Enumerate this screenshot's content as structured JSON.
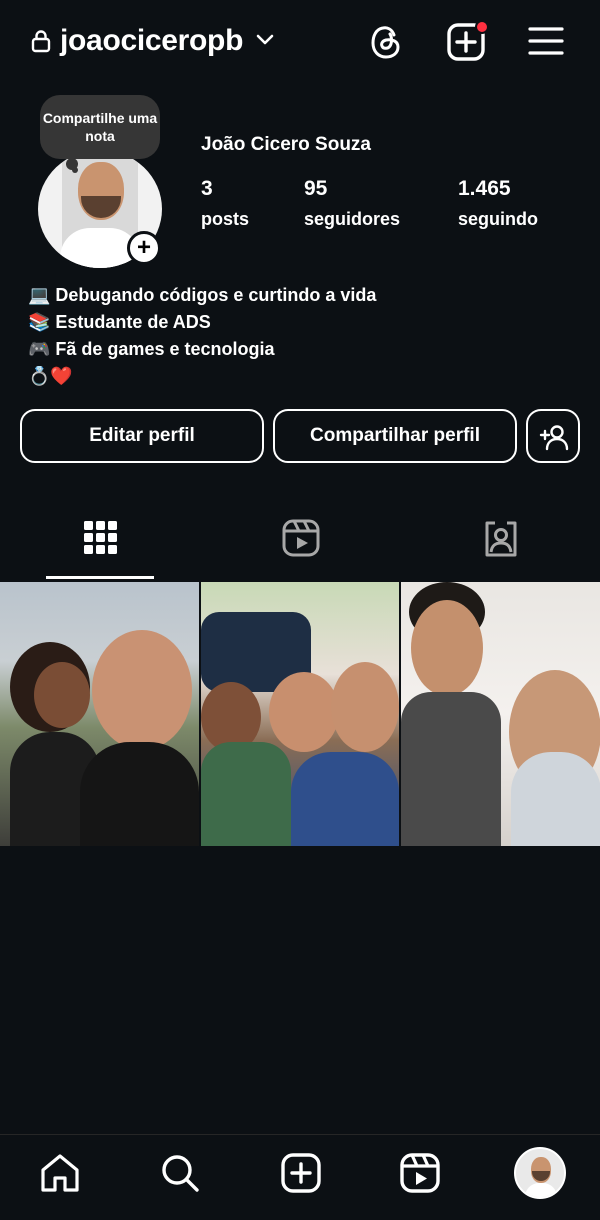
{
  "header": {
    "username": "joaociceropb",
    "icons": [
      "lock-icon",
      "chevron-down-icon",
      "threads-icon",
      "create-icon",
      "menu-icon"
    ],
    "notification_color": "#ff3040"
  },
  "profile": {
    "note_text": "Compartilhe uma nota",
    "add_note_symbol": "+",
    "full_name": "João Cicero Souza",
    "stats": [
      {
        "value": "3",
        "label": "posts"
      },
      {
        "value": "95",
        "label": "seguidores"
      },
      {
        "value": "1.465",
        "label": "seguindo"
      }
    ],
    "bio": [
      "💻 Debugando códigos e curtindo a vida",
      "📚 Estudante de ADS",
      "🎮 Fã de games e tecnologia",
      "💍❤️"
    ]
  },
  "actions": {
    "edit_label": "Editar perfil",
    "share_label": "Compartilhar perfil",
    "suggest_icon": "add-person-icon"
  },
  "tabs": [
    {
      "name": "posts",
      "icon": "grid-icon",
      "active": true
    },
    {
      "name": "reels",
      "icon": "reels-icon",
      "active": false
    },
    {
      "name": "tagged",
      "icon": "tagged-icon",
      "active": false
    }
  ],
  "posts": [
    {
      "id": 1
    },
    {
      "id": 2
    },
    {
      "id": 3
    }
  ],
  "bottom_nav": [
    "home-icon",
    "search-icon",
    "create-icon",
    "reels-icon",
    "profile-avatar"
  ],
  "colors": {
    "background": "#0c1014",
    "text": "#ffffff",
    "bubble": "#363636",
    "divider": "#262626"
  }
}
